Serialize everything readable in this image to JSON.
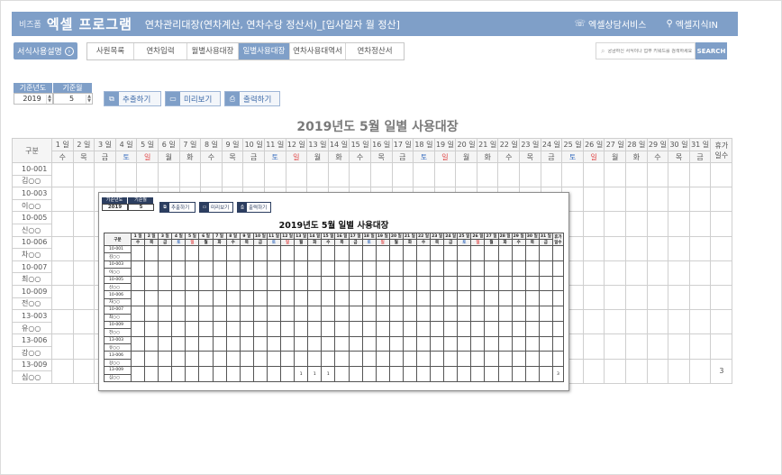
{
  "header": {
    "brand_sub": "비즈폼",
    "brand": "엑셀 프로그램",
    "subtitle": "연차관리대장(연차계산, 연차수당 정산서)_[입사일자 월 정산]",
    "consult_link": "엑셀상담서비스",
    "knowledge_link": "엑셀지식IN"
  },
  "nav": {
    "guide_label": "서식사용설명",
    "guide_icon": "›",
    "tabs": [
      {
        "label": "사원목록",
        "width": 52
      },
      {
        "label": "연차입력",
        "width": 59
      },
      {
        "label": "월별사용대장",
        "width": 57
      },
      {
        "label": "일별사용대장",
        "width": 57,
        "active": true
      },
      {
        "label": "연차사용대역서",
        "width": 62
      },
      {
        "label": "연차정산서",
        "width": 64
      }
    ],
    "search_placeholder": "궁금하신 서식이나 업무 키워드를 검색하세요",
    "search_button": "SEARCH"
  },
  "controls": {
    "year_label": "기준년도",
    "month_label": "기준월",
    "year_value": "2019",
    "month_value": "5",
    "extract_button": "추출하기",
    "preview_button": "미리보기",
    "print_button": "출력하기"
  },
  "sheet": {
    "title": "2019년도 5월 일별 사용대장",
    "col_header": "구분",
    "total_header_1": "휴가",
    "total_header_2": "일수",
    "days": [
      "1 일",
      "2 일",
      "3 일",
      "4 일",
      "5 일",
      "6 일",
      "7 일",
      "8 일",
      "9 일",
      "10 일",
      "11 일",
      "12 일",
      "13 일",
      "14 일",
      "15 일",
      "16 일",
      "17 일",
      "18 일",
      "19 일",
      "20 일",
      "21 일",
      "22 일",
      "23 일",
      "24 일",
      "25 일",
      "26 일",
      "27 일",
      "28 일",
      "29 일",
      "30 일",
      "31 일"
    ],
    "weekdays": [
      "수",
      "목",
      "금",
      "토",
      "일",
      "월",
      "화",
      "수",
      "목",
      "금",
      "토",
      "일",
      "월",
      "화",
      "수",
      "목",
      "금",
      "토",
      "일",
      "월",
      "화",
      "수",
      "목",
      "금",
      "토",
      "일",
      "월",
      "화",
      "수",
      "목",
      "금"
    ],
    "employees": [
      {
        "id": "10-001",
        "name": "김○○",
        "total": ""
      },
      {
        "id": "10-003",
        "name": "이○○",
        "total": ""
      },
      {
        "id": "10-005",
        "name": "신○○",
        "total": ""
      },
      {
        "id": "10-006",
        "name": "차○○",
        "total": ""
      },
      {
        "id": "10-007",
        "name": "최○○",
        "total": ""
      },
      {
        "id": "10-009",
        "name": "전○○",
        "total": ""
      },
      {
        "id": "13-003",
        "name": "유○○",
        "total": ""
      },
      {
        "id": "13-006",
        "name": "강○○",
        "total": ""
      },
      {
        "id": "13-009",
        "name": "심○○",
        "total": "3"
      }
    ],
    "last_row_marks": {
      "13": "1",
      "14": "1",
      "15": "1"
    }
  },
  "preview": {
    "year_label": "기준년도",
    "month_label": "기준월",
    "year_value": "2019",
    "month_value": "5",
    "extract_button": "추출하기",
    "preview_button": "미리보기",
    "print_button": "출력하기",
    "title": "2019년도 5월 일별 사용대장",
    "col_header": "구분",
    "total_header": "휴가 일수"
  },
  "colors": {
    "accent": "#7f9fc8",
    "saturday": "#3a6fc0",
    "sunday": "#e04848",
    "preview_dark": "#2c3e60"
  }
}
